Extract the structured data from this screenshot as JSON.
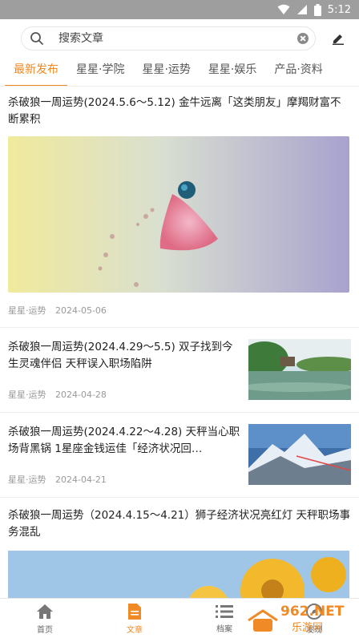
{
  "status_bar": {
    "time": "5:12"
  },
  "search": {
    "placeholder": "搜索文章"
  },
  "tabs": [
    "最新发布",
    "星星·学院",
    "星星·运势",
    "星星·娱乐",
    "产品·资料"
  ],
  "articles": [
    {
      "title": "杀破狼一周运势(2024.5.6～5.12) 金牛远离「这类朋友」摩羯财富不断累积",
      "category": "星星·运势",
      "date": "2024-05-06"
    },
    {
      "title": "杀破狼一周运势(2024.4.29～5.5) 双子找到今生灵魂伴侣 天秤误入职场陷阱",
      "category": "星星·运势",
      "date": "2024-04-28"
    },
    {
      "title": "杀破狼一周运势(2024.4.22～4.28) 天秤当心职场背黑锅 1星座金钱运佳「经济状况回…",
      "category": "星星·运势",
      "date": "2024-04-21"
    },
    {
      "title": "杀破狼一周运势（2024.4.15～4.21）狮子经济状况亮红灯 天秤职场事务混乱"
    }
  ],
  "bottom_nav": [
    {
      "label": "首页",
      "icon": "home-icon"
    },
    {
      "label": "文章",
      "icon": "article-icon"
    },
    {
      "label": "档案",
      "icon": "list-icon"
    },
    {
      "label": "发现",
      "icon": "discover-icon"
    }
  ],
  "watermark": {
    "domain": "962.NET",
    "site": "乐游网"
  },
  "colors": {
    "accent": "#f08a24",
    "status_bar": "#9e9e9e"
  }
}
